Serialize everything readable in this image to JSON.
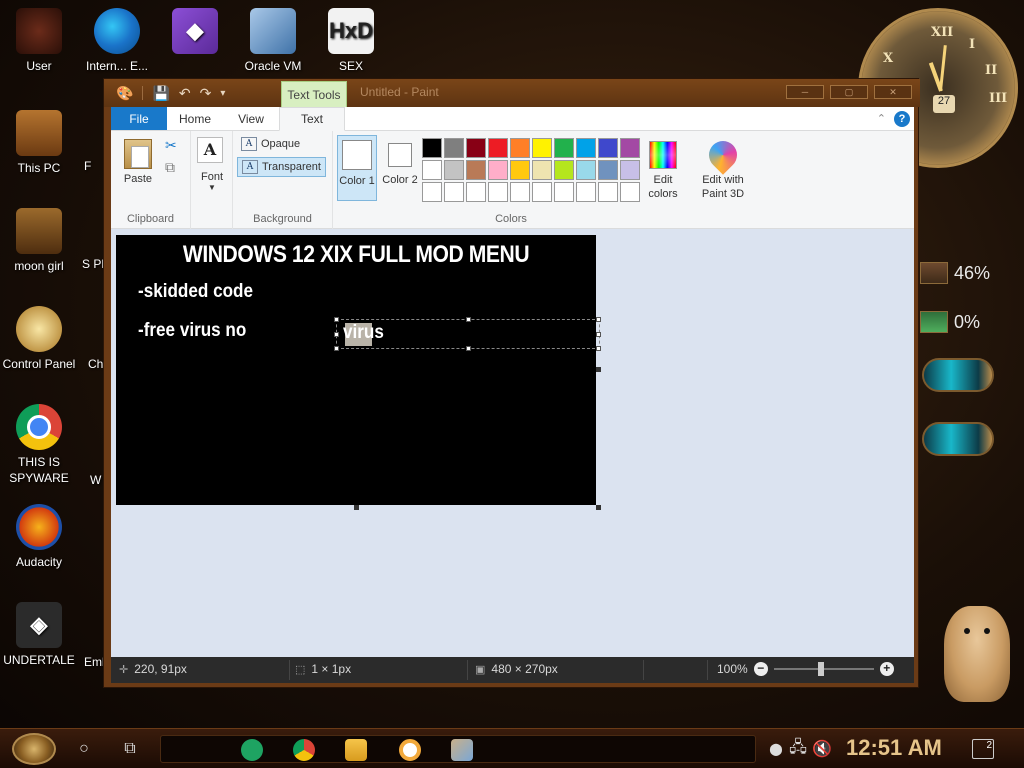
{
  "desktop": {
    "icons": [
      {
        "label": "User",
        "icon": "user-icon"
      },
      {
        "label": "Intern... E...",
        "icon": "edge-icon"
      },
      {
        "label": "",
        "icon": "visual-studio-icon"
      },
      {
        "label": "Oracle VM",
        "icon": "virtualbox-icon"
      },
      {
        "label": "SEX",
        "icon": "hxd-icon"
      },
      {
        "label": "This PC",
        "icon": "computer-icon"
      },
      {
        "label": "moon girl",
        "icon": "moon-girl-icon"
      },
      {
        "label": "Control Panel",
        "icon": "control-panel-icon"
      },
      {
        "label": "THIS IS SPYWARE",
        "icon": "chrome-icon"
      },
      {
        "label": "Audacity",
        "icon": "audacity-icon"
      },
      {
        "label": "UNDERTALE",
        "icon": "unity-icon"
      }
    ],
    "partial_labels": [
      "F",
      "S PHC",
      "Ch",
      "W",
      "l",
      "Emb D"
    ],
    "hxd_glyph": "HxD",
    "vs_glyph": "◆",
    "unity_glyph": "◈"
  },
  "gadgets": {
    "clock_day": "27",
    "clock_numerals": [
      "XII",
      "I",
      "II",
      "X",
      "IX",
      "III"
    ],
    "cpu": "46%",
    "mem": "0%"
  },
  "paint": {
    "window_title": "Untitled - Paint",
    "context_tab": "Text Tools",
    "tabs": {
      "file": "File",
      "home": "Home",
      "view": "View",
      "text": "Text"
    },
    "ribbon": {
      "clipboard": {
        "paste": "Paste",
        "label": "Clipboard"
      },
      "font": {
        "label": "Font",
        "glyph": "A"
      },
      "background": {
        "opaque": "Opaque",
        "transparent": "Transparent",
        "label": "Background"
      },
      "colors": {
        "color1": "Color 1",
        "color2": "Color 2",
        "edit_colors": "Edit colors",
        "paint3d": "Edit with Paint 3D",
        "label": "Colors",
        "palette": [
          "#000000",
          "#7f7f7f",
          "#880015",
          "#ed1c24",
          "#ff7f27",
          "#fff200",
          "#22b14c",
          "#00a2e8",
          "#3f48cc",
          "#a349a4",
          "#ffffff",
          "#c3c3c3",
          "#b97a57",
          "#ffaec9",
          "#ffc90e",
          "#efe4b0",
          "#b5e61d",
          "#99d9ea",
          "#7092be",
          "#c8bfe7",
          "#ffffff",
          "#ffffff",
          "#ffffff",
          "#ffffff",
          "#ffffff",
          "#ffffff",
          "#ffffff",
          "#ffffff",
          "#ffffff",
          "#ffffff"
        ]
      }
    },
    "canvas": {
      "title": "WINDOWS 12 XIX FULL MOD MENU",
      "line1": "-skidded code",
      "line2": "-free virus no",
      "textbox": "virus"
    },
    "status": {
      "cursor": "220, 91px",
      "selection": "1 × 1px",
      "image_size": "480 × 270px",
      "zoom": "100%"
    }
  },
  "taskbar": {
    "time": "12:51 AM",
    "notifications": "2"
  }
}
